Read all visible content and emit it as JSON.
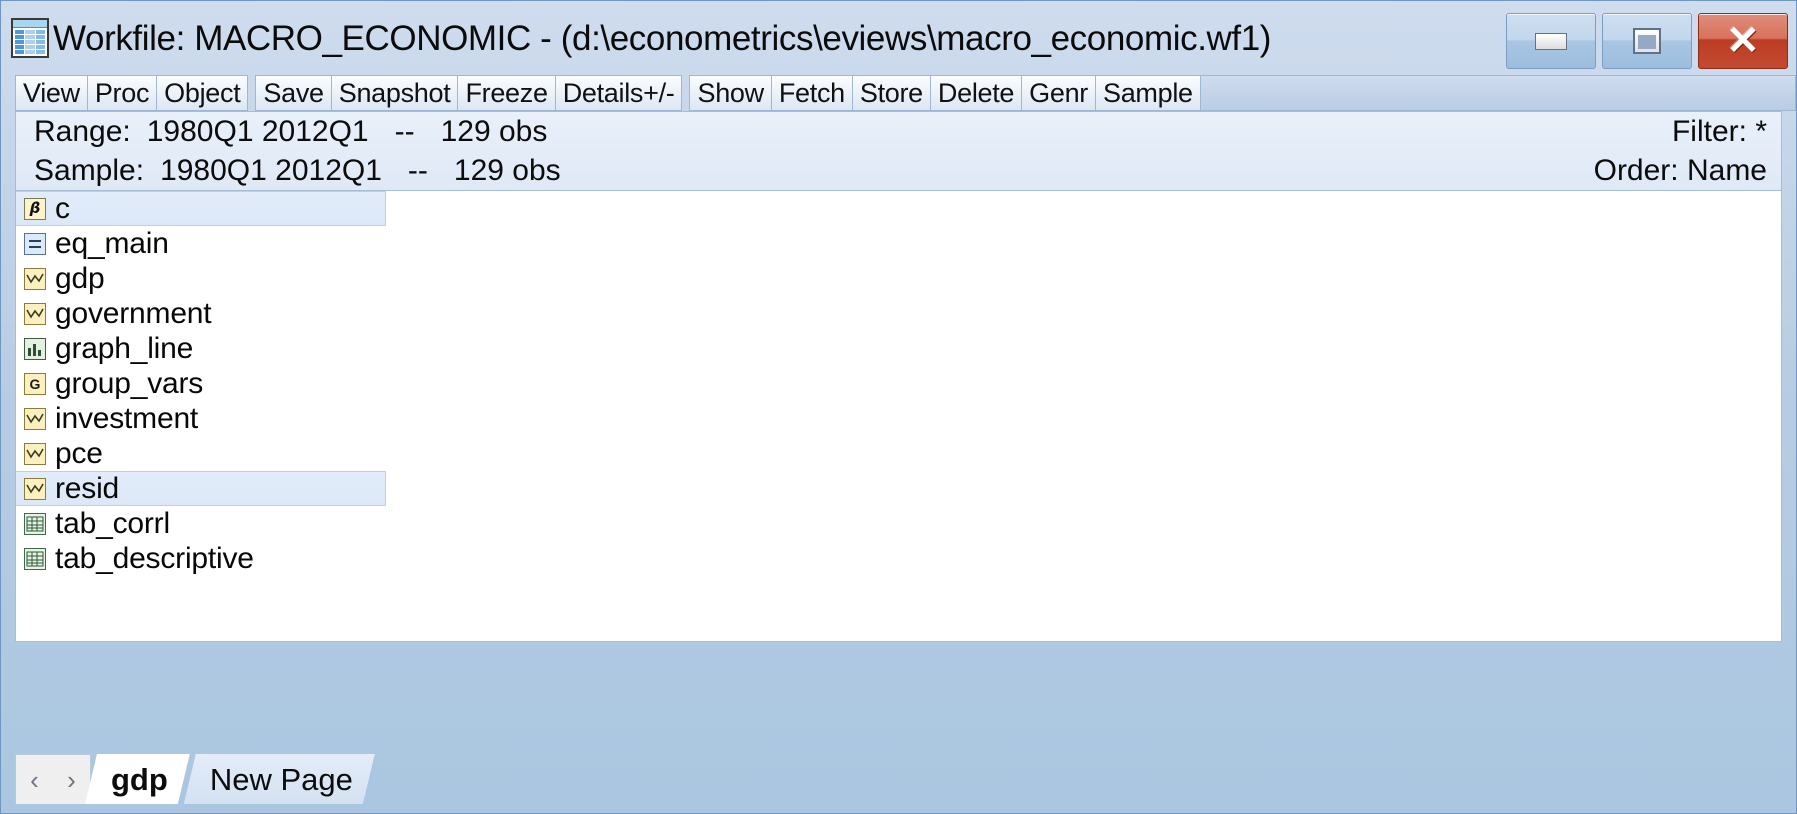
{
  "window": {
    "icon": "workfile-grid-icon",
    "title": "Workfile: MACRO_ECONOMIC - (d:\\econometrics\\eviews\\macro_economic.wf1)",
    "controls": {
      "minimize": "minimize-icon",
      "maximize": "maximize-icon",
      "close": "✕"
    }
  },
  "toolbar": {
    "groups": [
      {
        "buttons": [
          "View",
          "Proc",
          "Object"
        ]
      },
      {
        "buttons": [
          "Save",
          "Snapshot",
          "Freeze",
          "Details+/-"
        ]
      },
      {
        "buttons": [
          "Show",
          "Fetch",
          "Store",
          "Delete",
          "Genr",
          "Sample"
        ]
      }
    ]
  },
  "info": {
    "range": {
      "label": "Range:",
      "value": "1980Q1 2012Q1",
      "dash": "--",
      "obs": "129 obs"
    },
    "sample": {
      "label": "Sample:",
      "value": "1980Q1 2012Q1",
      "dash": "--",
      "obs": "129 obs"
    },
    "filter": "Filter: *",
    "order": "Order: Name"
  },
  "objects": [
    {
      "name": "c",
      "type": "coef",
      "icon": "coefficient-icon",
      "selected": true
    },
    {
      "name": "eq_main",
      "type": "equation",
      "icon": "equation-icon",
      "selected": false
    },
    {
      "name": "gdp",
      "type": "series",
      "icon": "series-icon",
      "selected": false
    },
    {
      "name": "government",
      "type": "series",
      "icon": "series-icon",
      "selected": false
    },
    {
      "name": "graph_line",
      "type": "graph",
      "icon": "graph-icon",
      "selected": false
    },
    {
      "name": "group_vars",
      "type": "group",
      "icon": "group-icon",
      "selected": false
    },
    {
      "name": "investment",
      "type": "series",
      "icon": "series-icon",
      "selected": false
    },
    {
      "name": "pce",
      "type": "series",
      "icon": "series-icon",
      "selected": false
    },
    {
      "name": "resid",
      "type": "series",
      "icon": "series-icon",
      "selected": true
    },
    {
      "name": "tab_corrl",
      "type": "table",
      "icon": "table-icon",
      "selected": false
    },
    {
      "name": "tab_descriptive",
      "type": "table",
      "icon": "table-icon",
      "selected": false
    }
  ],
  "pagetabs": {
    "prev": "‹",
    "next": "›",
    "tabs": [
      {
        "label": "gdp",
        "active": true
      },
      {
        "label": "New Page",
        "active": false
      }
    ]
  },
  "colors": {
    "titlebar_top": "#cfdcee",
    "titlebar_bottom": "#aac6e0",
    "close_button": "#bc3c23",
    "selection": "#dce8f8",
    "series_icon": "#fdf0bf",
    "table_icon": "#e7f3e4",
    "frame_border": "#6f96c0"
  }
}
